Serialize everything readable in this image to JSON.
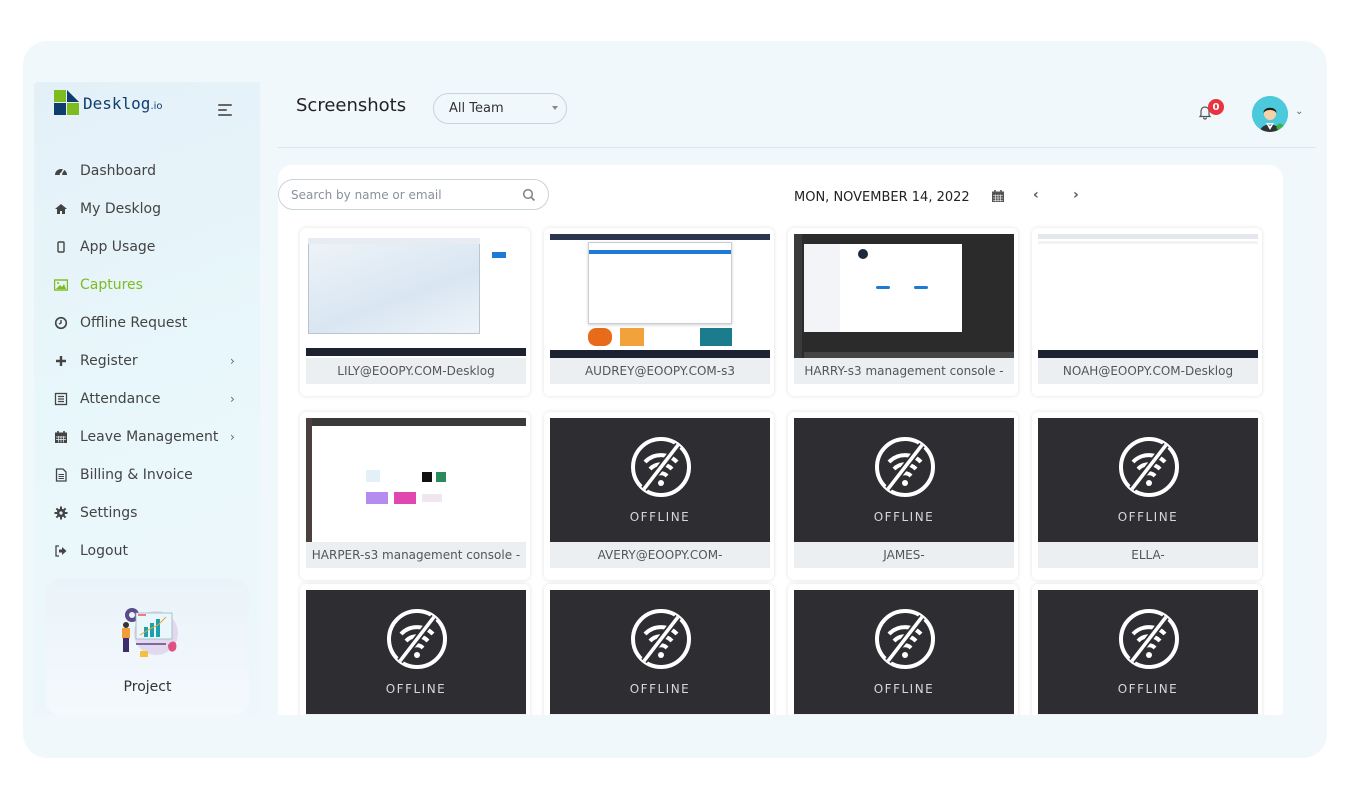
{
  "brand": {
    "name": "Desklog",
    "suffix": ".io"
  },
  "sidebar": {
    "items": [
      {
        "label": "Dashboard",
        "icon": "dashboard-icon"
      },
      {
        "label": "My Desklog",
        "icon": "home-icon"
      },
      {
        "label": "App Usage",
        "icon": "mobile-icon"
      },
      {
        "label": "Captures",
        "icon": "image-icon",
        "active": true
      },
      {
        "label": "Offline Request",
        "icon": "clock-icon"
      },
      {
        "label": "Register",
        "icon": "plus-icon",
        "submenu": true
      },
      {
        "label": "Attendance",
        "icon": "list-icon",
        "submenu": true
      },
      {
        "label": "Leave Management",
        "icon": "calendar-icon",
        "submenu": true
      },
      {
        "label": "Billing & Invoice",
        "icon": "file-icon"
      },
      {
        "label": "Settings",
        "icon": "gear-icon"
      },
      {
        "label": "Logout",
        "icon": "logout-icon"
      }
    ],
    "project_card": {
      "label": "Project"
    }
  },
  "header": {
    "title": "Screenshots",
    "team_filter": {
      "selected": "All Team"
    },
    "notifications": {
      "count": "0"
    }
  },
  "toolbar": {
    "search_placeholder": "Search by name or email",
    "date": "MON, NOVEMBER 14, 2022"
  },
  "colors": {
    "accent": "#7dbb1e",
    "brand_dark": "#0f3d6e",
    "badge": "#e8343f",
    "offline_bg": "#2e2e32"
  },
  "screenshots": [
    {
      "caption": "LILY@EOOPY.COM-Desklog",
      "status": "captured"
    },
    {
      "caption": "AUDREY@EOOPY.COM-s3",
      "status": "captured"
    },
    {
      "caption": "HARRY-s3 management console -",
      "status": "captured"
    },
    {
      "caption": "NOAH@EOOPY.COM-Desklog",
      "status": "captured"
    },
    {
      "caption": "HARPER-s3 management console -",
      "status": "captured"
    },
    {
      "caption": "AVERY@EOOPY.COM-",
      "status": "offline",
      "offline_label": "OFFLINE"
    },
    {
      "caption": "JAMES-",
      "status": "offline",
      "offline_label": "OFFLINE"
    },
    {
      "caption": "ELLA-",
      "status": "offline",
      "offline_label": "OFFLINE"
    },
    {
      "caption": "",
      "status": "offline",
      "offline_label": "OFFLINE"
    },
    {
      "caption": "",
      "status": "offline",
      "offline_label": "OFFLINE"
    },
    {
      "caption": "",
      "status": "offline",
      "offline_label": "OFFLINE"
    },
    {
      "caption": "",
      "status": "offline",
      "offline_label": "OFFLINE"
    }
  ]
}
